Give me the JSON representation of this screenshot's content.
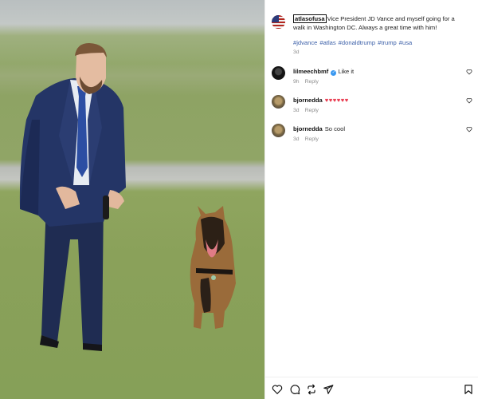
{
  "post": {
    "author": "atlasofusa",
    "caption": "Vice President JD Vance and myself going for a walk in Washington DC. Always a great time with him!",
    "hashtags": [
      "#jdvance",
      "#atlas",
      "#donaldtrump",
      "#trump",
      "#usa"
    ],
    "age": "3d"
  },
  "comments": [
    {
      "user": "lilmeechbmf",
      "verified": true,
      "text": "Like it",
      "age": "9h",
      "reply_label": "Reply"
    },
    {
      "user": "bjornedda",
      "verified": false,
      "text": "♥♥♥♥♥♥",
      "age": "3d",
      "reply_label": "Reply"
    },
    {
      "user": "bjornedda",
      "verified": false,
      "text": "So cool",
      "age": "3d",
      "reply_label": "Reply"
    }
  ],
  "icons": [
    "heart-icon",
    "comment-icon",
    "repost-icon",
    "share-icon",
    "save-icon"
  ],
  "colors": {
    "hashtag": "#3b5fa8",
    "verified": "#3897f0",
    "hearts": "#e8364b"
  }
}
